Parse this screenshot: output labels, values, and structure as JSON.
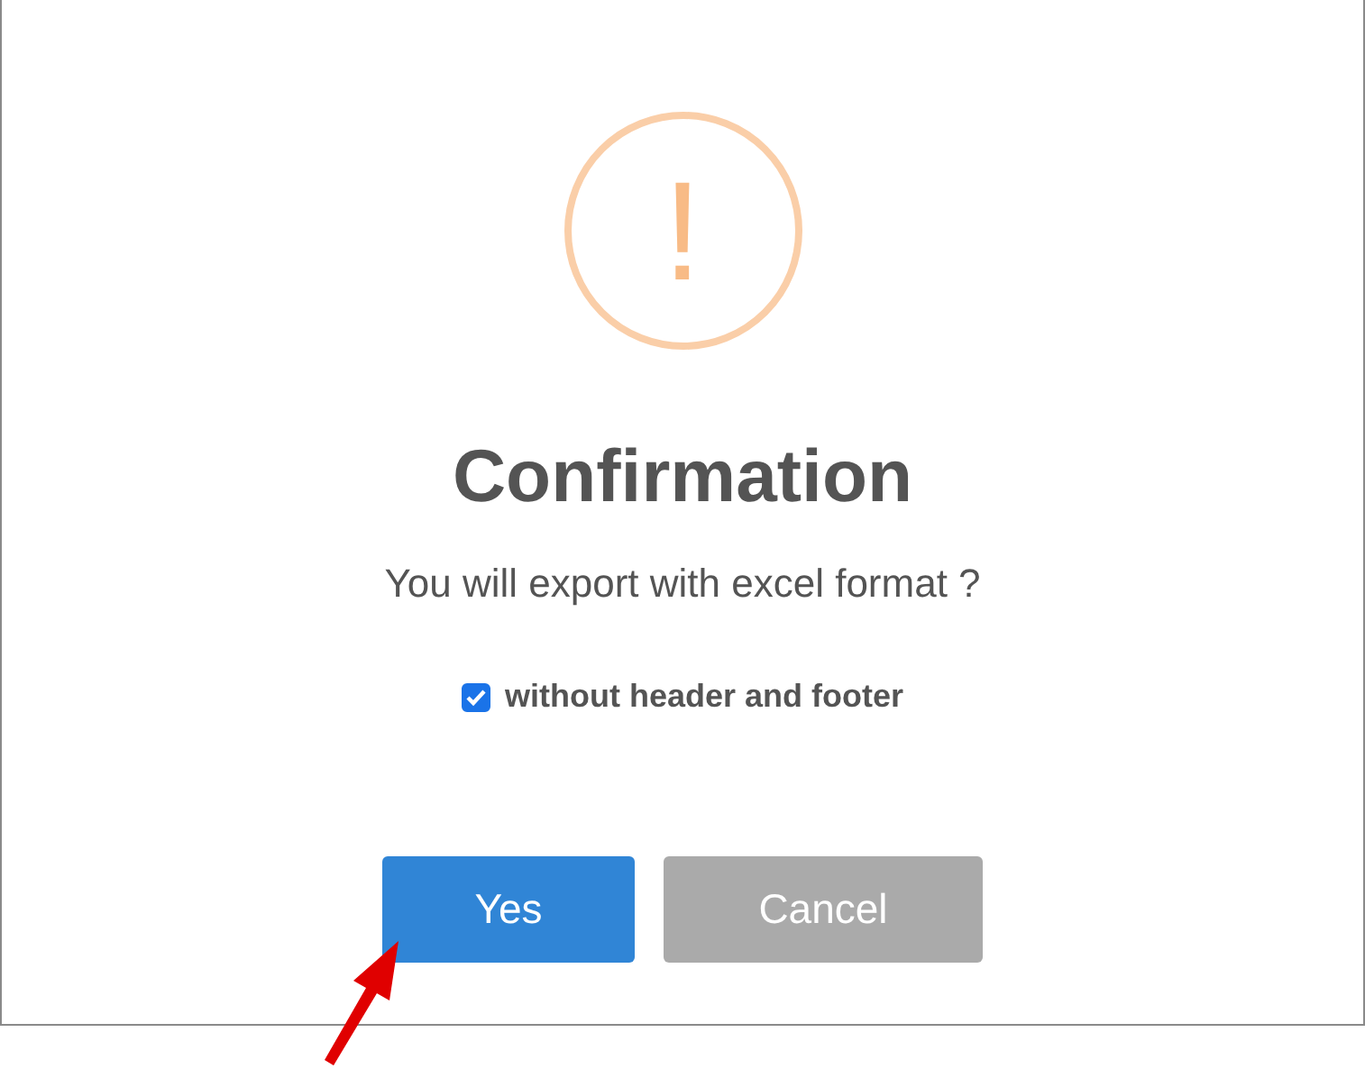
{
  "icon": {
    "glyph": "!"
  },
  "title": "Confirmation",
  "message": "You will export with excel format ?",
  "option": {
    "label": "without header and footer",
    "checked": true
  },
  "buttons": [
    {
      "label": "Yes",
      "kind": "confirm"
    },
    {
      "label": "Cancel",
      "kind": "cancel"
    }
  ]
}
